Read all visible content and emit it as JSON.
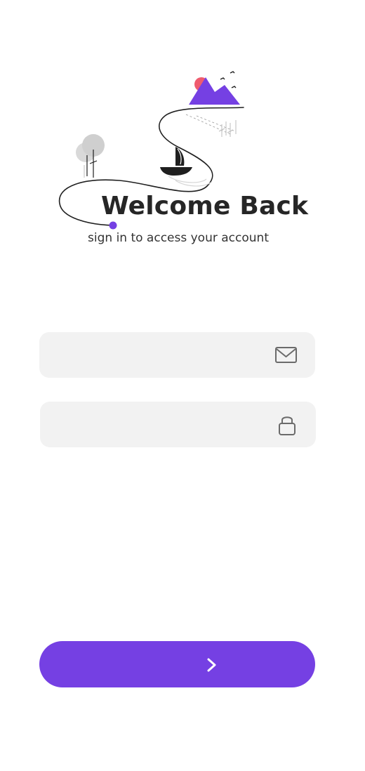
{
  "header": {
    "title": "Welcome Back",
    "subtitle": "sign in to access your account"
  },
  "form": {
    "email": {
      "value": "",
      "placeholder": "",
      "icon": "mail-icon"
    },
    "password": {
      "value": "",
      "placeholder": "",
      "icon": "lock-icon"
    },
    "submit": {
      "icon": "chevron-right-icon"
    }
  },
  "illustration": {
    "name": "landscape-path-illustration",
    "elements": [
      "mountains",
      "sun",
      "birds",
      "sailboat",
      "trees",
      "winding-path"
    ]
  },
  "colors": {
    "accent": "#7540e3",
    "field_background": "#f2f2f2",
    "sun": "#ef5b6e",
    "text": "#262626"
  }
}
